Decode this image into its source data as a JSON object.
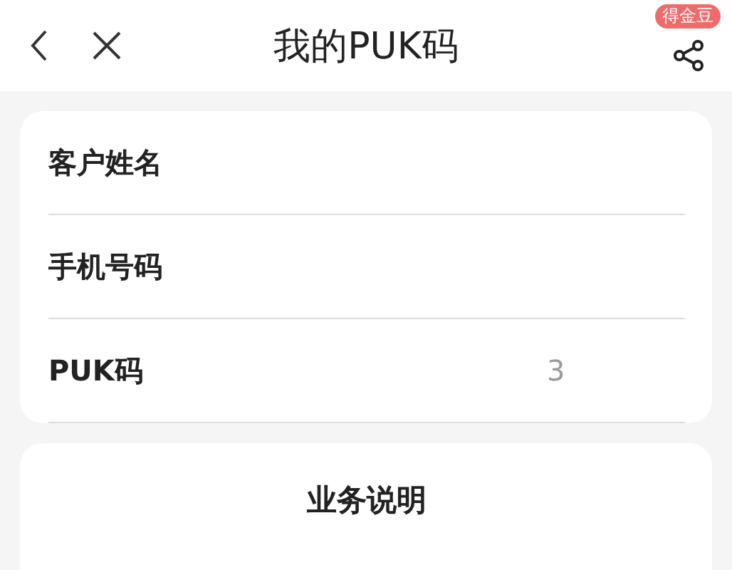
{
  "header": {
    "title": "我的PUK码",
    "badge": "得金豆"
  },
  "fields": [
    {
      "label": "客户姓名"
    },
    {
      "label": "手机号码"
    },
    {
      "label": "PUK码",
      "value": "3"
    }
  ],
  "notice": {
    "title": "业务说明"
  }
}
